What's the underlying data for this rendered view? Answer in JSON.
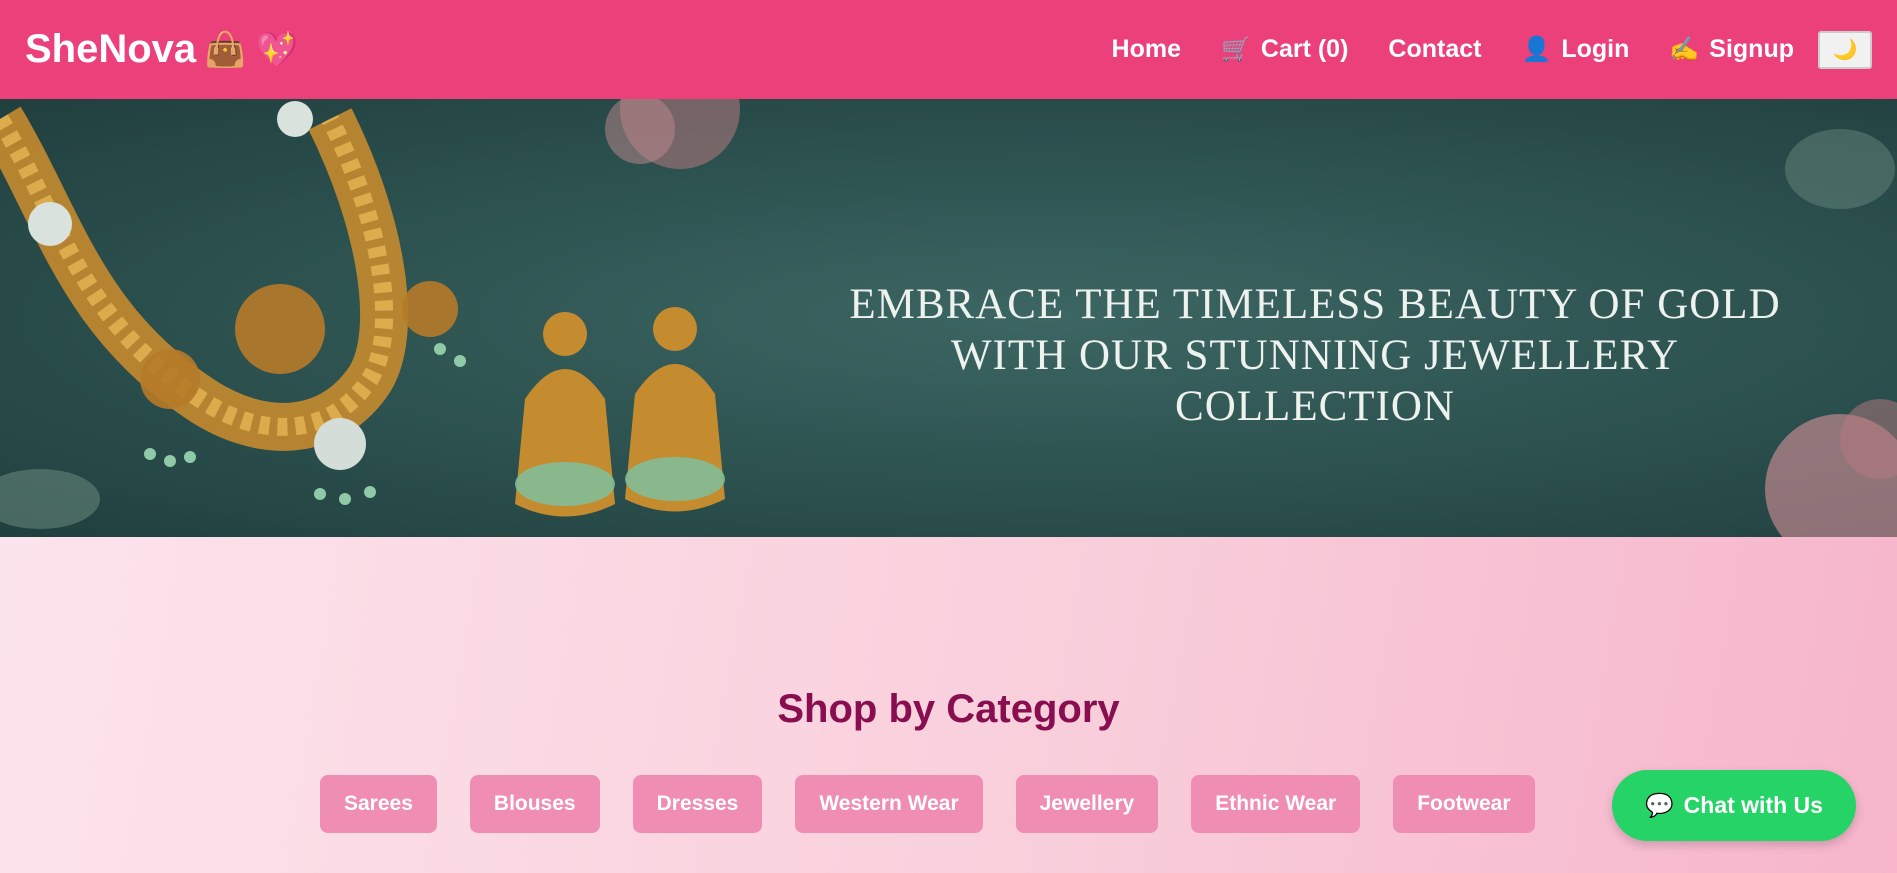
{
  "brand": {
    "name": "SheNova",
    "emojis": "👜 💖"
  },
  "nav": {
    "home": "Home",
    "cart_icon": "🛒",
    "cart": "Cart (0)",
    "contact": "Contact",
    "login_icon": "👤",
    "login": "Login",
    "signup_icon": "✍️",
    "signup": "Signup",
    "theme_toggle_icon": "🌙"
  },
  "banner": {
    "line1": "EMBRACE THE TIMELESS BEAUTY OF GOLD",
    "line2": "WITH OUR STUNNING JEWELLERY COLLECTION"
  },
  "categories": {
    "title": "Shop by Category",
    "items": [
      "Sarees",
      "Blouses",
      "Dresses",
      "Western Wear",
      "Jewellery",
      "Ethnic Wear",
      "Footwear"
    ]
  },
  "chat": {
    "icon": "💬",
    "label": "Chat with Us"
  },
  "colors": {
    "navbar": "#ec407a",
    "category_button": "#f08db3",
    "title": "#880e4f",
    "chat_button": "#25d366",
    "banner_bg": "#2c514f"
  }
}
